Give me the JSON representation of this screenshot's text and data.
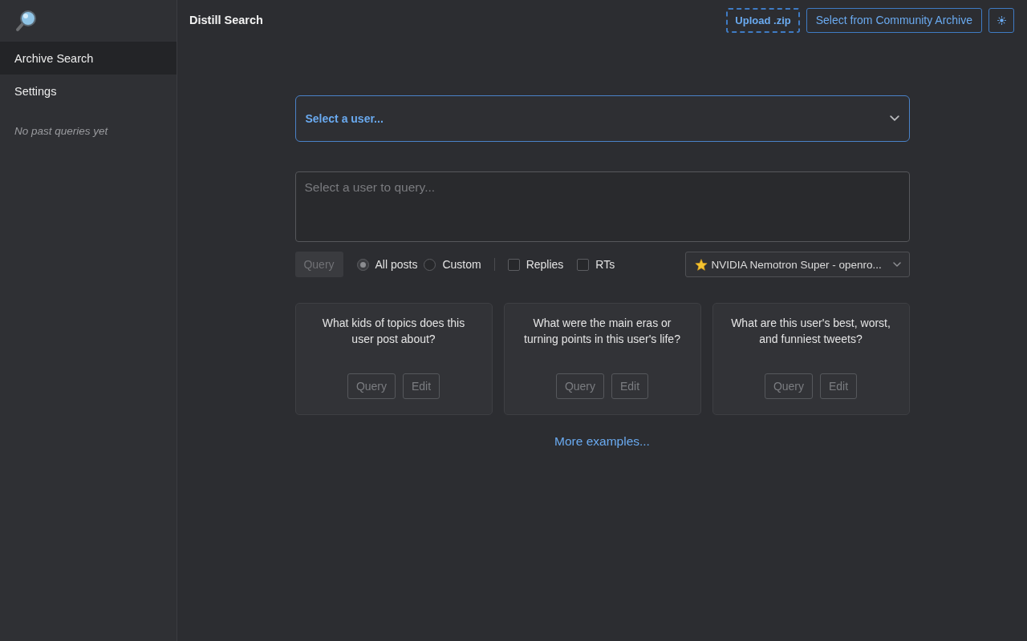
{
  "sidebar": {
    "items": [
      {
        "label": "Archive Search",
        "selected": true
      },
      {
        "label": "Settings",
        "selected": false
      }
    ],
    "empty_note": "No past queries yet"
  },
  "header": {
    "title": "Distill Search",
    "buttons": [
      {
        "kind": "dashed",
        "label": "Upload .zip"
      },
      {
        "kind": "outline",
        "label": "Select from Community Archive"
      },
      {
        "kind": "theme"
      }
    ]
  },
  "user_select": {
    "placeholder": "Select a user..."
  },
  "query_box": {
    "placeholder": "Select a user to query..."
  },
  "options": {
    "query_button": {
      "label": "Query",
      "disabled": true
    },
    "scope": [
      {
        "label": "All posts",
        "selected": true
      },
      {
        "label": "Custom",
        "selected": false
      }
    ],
    "filters": [
      {
        "label": "Replies",
        "checked": false
      },
      {
        "label": "RTs",
        "checked": false
      }
    ],
    "model": {
      "value": "NVIDIA Nemotron Super - openro..."
    }
  },
  "examples": [
    {
      "question": "What kids of topics does this user post about?",
      "buttons": [
        {
          "label": "Query",
          "disabled": true
        },
        {
          "label": "Edit",
          "disabled": true
        }
      ]
    },
    {
      "question": "What were the main eras or turning points in this user's life?",
      "buttons": [
        {
          "label": "Query",
          "disabled": true
        },
        {
          "label": "Edit",
          "disabled": true
        }
      ]
    },
    {
      "question": "What are this user's best, worst, and funniest tweets?",
      "buttons": [
        {
          "label": "Query",
          "disabled": true
        },
        {
          "label": "Edit",
          "disabled": true
        }
      ]
    }
  ],
  "more_link": "More examples..."
}
